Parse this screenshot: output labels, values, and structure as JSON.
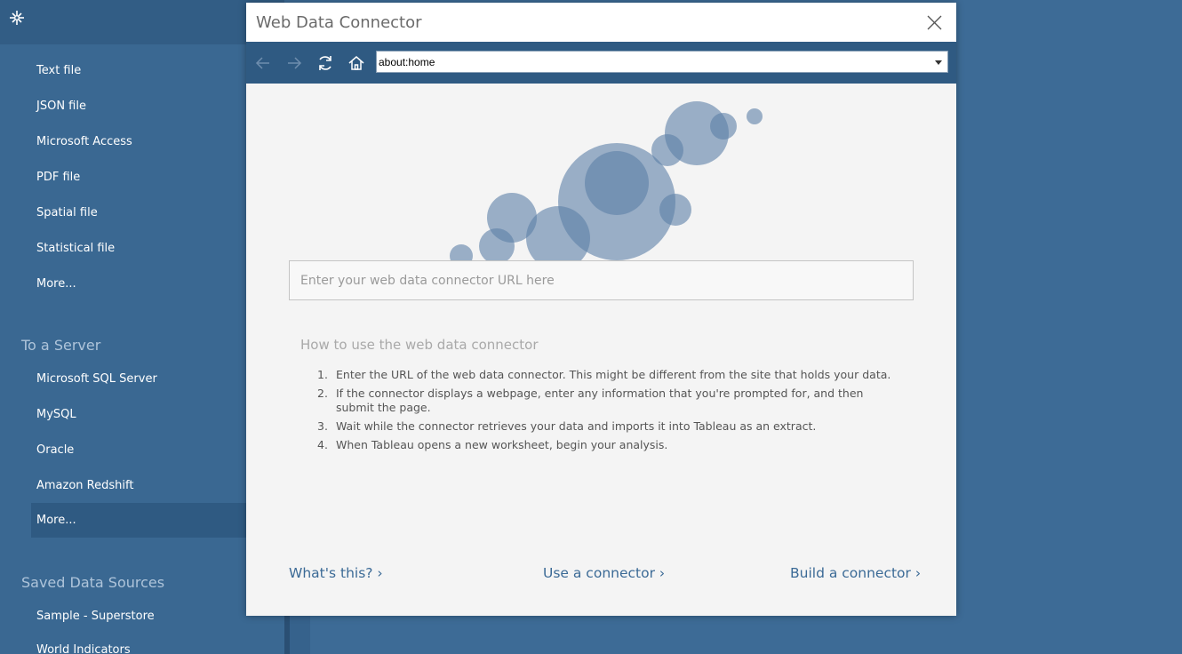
{
  "sidebar": {
    "file_items": [
      "Text file",
      "JSON file",
      "Microsoft Access",
      "PDF file",
      "Spatial file",
      "Statistical file",
      "More..."
    ],
    "server_heading": "To a Server",
    "server_items": [
      "Microsoft SQL Server",
      "MySQL",
      "Oracle",
      "Amazon Redshift",
      "More..."
    ],
    "saved_heading": "Saved Data Sources",
    "saved_items": [
      "Sample - Superstore",
      "World Indicators"
    ],
    "selected_item": "More..."
  },
  "dialog": {
    "title": "Web Data Connector",
    "toolbar": {
      "back_icon": "arrow-left-icon",
      "forward_icon": "arrow-right-icon",
      "refresh_icon": "refresh-icon",
      "home_icon": "home-icon",
      "url": "about:home"
    },
    "search": {
      "placeholder": "Enter your web data connector URL here"
    },
    "howto_title": "How to use the web data connector",
    "steps": [
      "Enter the URL of the web data connector. This might be different from the site that holds your data.",
      "If the connector displays a webpage, enter any information that you're prompted for, and then submit the page.",
      "Wait while the connector retrieves your data and imports it into Tableau as an extract.",
      "When Tableau opens a new worksheet, begin your analysis."
    ],
    "links": {
      "whats_this": "What's this? ›",
      "use_connector": "Use a connector ›",
      "build_connector": "Build a connector ›"
    }
  },
  "colors": {
    "sidebar_bg": "#3a6892",
    "toolbar_bg": "#2f5a82",
    "bubble": "#5b7fa6",
    "link": "#3b6a96"
  }
}
